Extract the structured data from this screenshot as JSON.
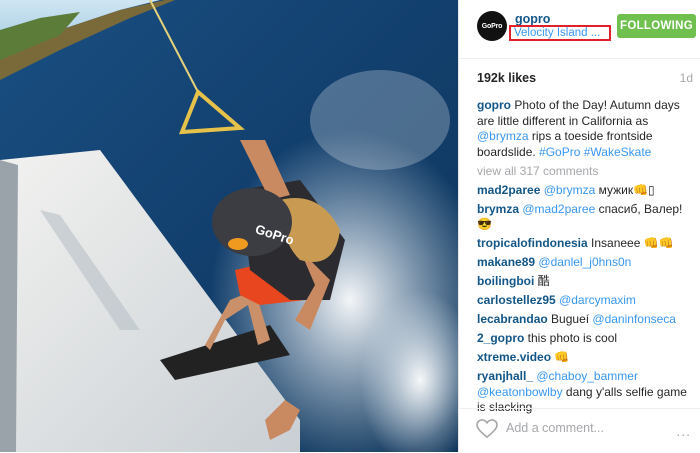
{
  "header": {
    "avatar_text": "GoPro",
    "username": "gopro",
    "location": "Velocity Island ...",
    "follow_label": "FOLLOWING"
  },
  "stats": {
    "likes": "192k likes",
    "age": "1d"
  },
  "caption": {
    "user": "gopro",
    "text1": "Photo of the Day! Autumn days are little different in California as ",
    "mention": "@brymza",
    "text2": " rips a toeside frontside boardslide. ",
    "tag1": "#GoPro",
    "tag2": "#WakeSkate"
  },
  "view_all": "view all 317 comments",
  "comments": [
    {
      "user": "mad2paree",
      "mention": "@brymza",
      "text": " мужик👊▯"
    },
    {
      "user": "brymza",
      "mention": "@mad2paree",
      "text": " спасиб, Валер! 😎"
    },
    {
      "user": "tropicalofindonesia",
      "mention": "",
      "text": " Insaneee 👊👊"
    },
    {
      "user": "makane89",
      "mention": "@danlel_j0hns0n",
      "text": ""
    },
    {
      "user": "boilingboi",
      "mention": "",
      "text": " 酷"
    },
    {
      "user": "carlostellez95",
      "mention": "@darcymaxim",
      "text": ""
    },
    {
      "user": "lecabrandao",
      "mention": "",
      "text": " Bugueí ",
      "mention2": "@daninfonseca"
    },
    {
      "user": "2_gopro",
      "mention": "",
      "text": " this photo is cool"
    },
    {
      "user": "xtreme.video",
      "mention": "",
      "text": " 👊"
    },
    {
      "user": "ryanjhall_",
      "mention": "@chaboy_bammer",
      "text": " ",
      "mention2": "@keatonbowlby",
      "text2": " dang y'alls selfie game is slacking"
    }
  ],
  "add_comment_placeholder": "Add a comment...",
  "more_label": "...",
  "colors": {
    "username": "#125688",
    "link": "#3897f0",
    "follow": "#70c050",
    "highlight": "#e0202a"
  }
}
